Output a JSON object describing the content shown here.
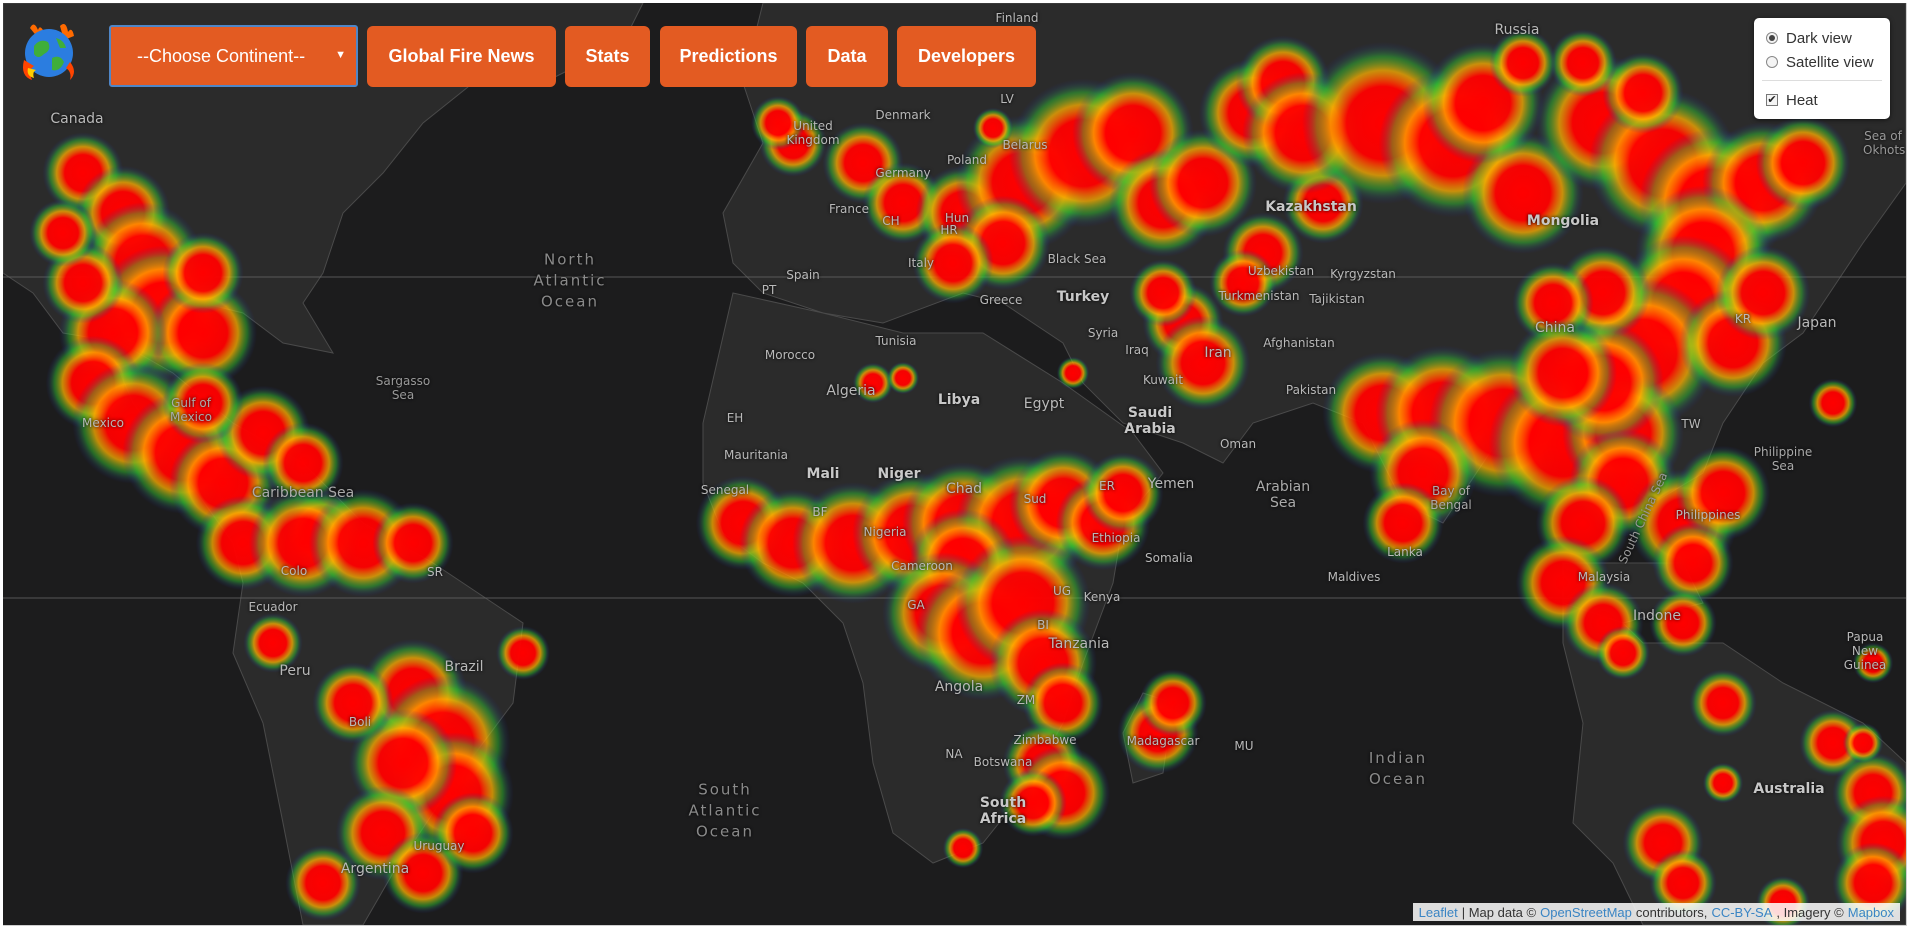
{
  "nav": {
    "select_value": "--Choose Continent--",
    "buttons": [
      {
        "id": "global-fire-news",
        "label": "Global Fire News"
      },
      {
        "id": "stats",
        "label": "Stats"
      },
      {
        "id": "predictions",
        "label": "Predictions"
      },
      {
        "id": "data",
        "label": "Data"
      },
      {
        "id": "developers",
        "label": "Developers"
      }
    ]
  },
  "layer_control": {
    "dark_view": "Dark view",
    "satellite_view": "Satellite view",
    "heat": "Heat",
    "selected_base": "dark_view",
    "heat_checked": true
  },
  "attribution": {
    "leaflet": "Leaflet",
    "sep": " | Map data © ",
    "osm": "OpenStreetMap",
    "contributors": " contributors, ",
    "license": "CC-BY-SA",
    "imagery": ", Imagery © ",
    "mapbox": "Mapbox"
  },
  "colors": {
    "accent": "#e35b22",
    "map_bg": "#1c1c1d",
    "land": "#2b2b2b",
    "heat_core": "#ff0000",
    "heat_mid": "#ffbb00",
    "heat_edge": "#33cc33"
  },
  "labels": {
    "canada": "Canada",
    "finland": "Finland",
    "russia": "Russia",
    "denmark": "Denmark",
    "united_kingdom": "United Kingdom",
    "poland": "Poland",
    "belarus": "Belarus",
    "lv": "LV",
    "germany": "Germany",
    "france": "France",
    "ch": "CH",
    "hun": "Hun",
    "hr": "HR",
    "italy": "Italy",
    "spain": "Spain",
    "pt": "PT",
    "black_sea": "Black Sea",
    "greece": "Greece",
    "turkey": "Turkey",
    "kazakhstan": "Kazakhstan",
    "mongolia": "Mongolia",
    "uzbekistan": "Uzbekistan",
    "kyrgyzstan": "Kyrgyzstan",
    "turkmenistan": "Turkmenistan",
    "tajikistan": "Tajikistan",
    "afghanistan": "Afghanistan",
    "pakistan": "Pakistan",
    "china": "China",
    "japan": "Japan",
    "kr": "KR",
    "tw": "TW",
    "north_atlantic": "North Atlantic Ocean",
    "sargasso": "Sargasso Sea",
    "gulf_mexico": "Gulf of Mexico",
    "mexico": "Mexico",
    "caribbean": "Caribbean Sea",
    "tunisia": "Tunisia",
    "morocco": "Morocco",
    "algeria": "Algeria",
    "libya": "Libya",
    "egypt": "Egypt",
    "syria": "Syria",
    "iraq": "Iraq",
    "iran": "Iran",
    "kuwait": "Kuwait",
    "saudi_arabia": "Saudi Arabia",
    "oman": "Oman",
    "yemen": "Yemen",
    "arabian_sea": "Arabian Sea",
    "eh": "EH",
    "mauritania": "Mauritania",
    "mali": "Mali",
    "niger": "Niger",
    "chad": "Chad",
    "sudan": "Sud",
    "senegal": "Senegal",
    "bf": "BF",
    "nigeria": "Nigeria",
    "cameroon": "Cameroon",
    "ethiopia": "Ethiopia",
    "er": "ER",
    "somalia": "Somalia",
    "ga": "GA",
    "ug": "UG",
    "kenya": "Kenya",
    "bi": "BI",
    "tanzania": "Tanzania",
    "angola": "Angola",
    "zm": "ZM",
    "zimbabwe": "Zimbabwe",
    "na": "NA",
    "botswana": "Botswana",
    "madagascar": "Madagascar",
    "mu": "MU",
    "south_africa": "South Africa",
    "maldives": "Maldives",
    "bay_bengal": "Bay of Bengal",
    "lanka": "Lanka",
    "south_china_sea": "South China Sea",
    "philippine_sea": "Philippine Sea",
    "philippines": "Philippines",
    "malaysia": "Malaysia",
    "indonesia": "Indone",
    "papua": "Papua New Guinea",
    "australia": "Australia",
    "indian_ocean": "Indian Ocean",
    "south_atlantic": "South Atlantic Ocean",
    "colombia": "Colo",
    "ecuador": "Ecuador",
    "peru": "Peru",
    "brazil": "Brazil",
    "bolivia": "Boli",
    "argentina": "Argentina",
    "uruguay": "Uruguay",
    "sr": "SR",
    "sea_okhotsk": "Sea of Okhots"
  }
}
